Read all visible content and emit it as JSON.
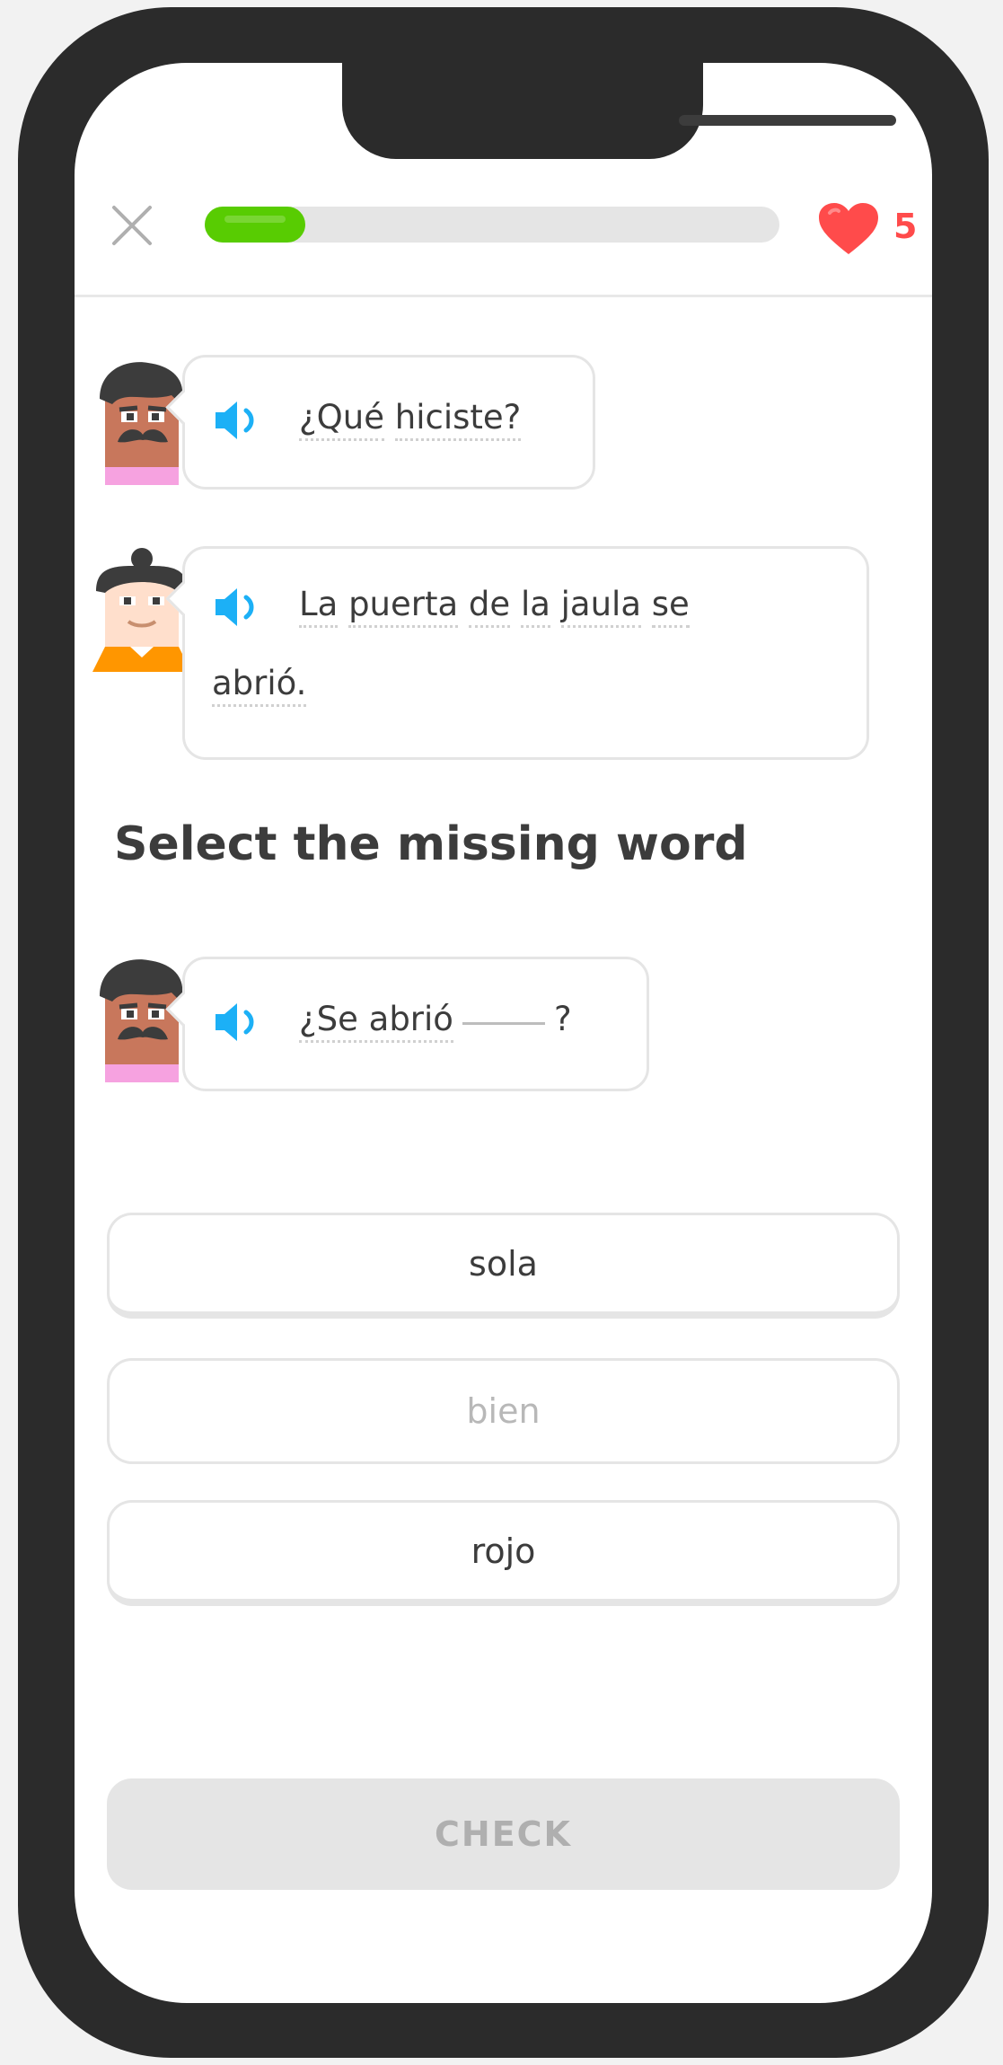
{
  "header": {
    "progress": 0.175,
    "hearts": "5"
  },
  "dialogue": [
    {
      "speaker": "man",
      "line1": [
        "¿Qué",
        "hiciste?"
      ]
    },
    {
      "speaker": "woman",
      "line1": [
        "La",
        "puerta",
        "de",
        "la",
        "jaula",
        "se"
      ],
      "line2": [
        "abrió."
      ]
    }
  ],
  "instruction": "Select the missing word",
  "prompt": {
    "speaker": "man",
    "before": "¿Se abrió",
    "after": "?"
  },
  "options": [
    {
      "label": "sola",
      "state": "enabled"
    },
    {
      "label": "bien",
      "state": "disabled"
    },
    {
      "label": "rojo",
      "state": "enabled"
    }
  ],
  "check_label": "CHECK",
  "colors": {
    "progress": "#58cc02",
    "heart": "#ff4b4b",
    "speaker_icon": "#1cb0f6"
  }
}
